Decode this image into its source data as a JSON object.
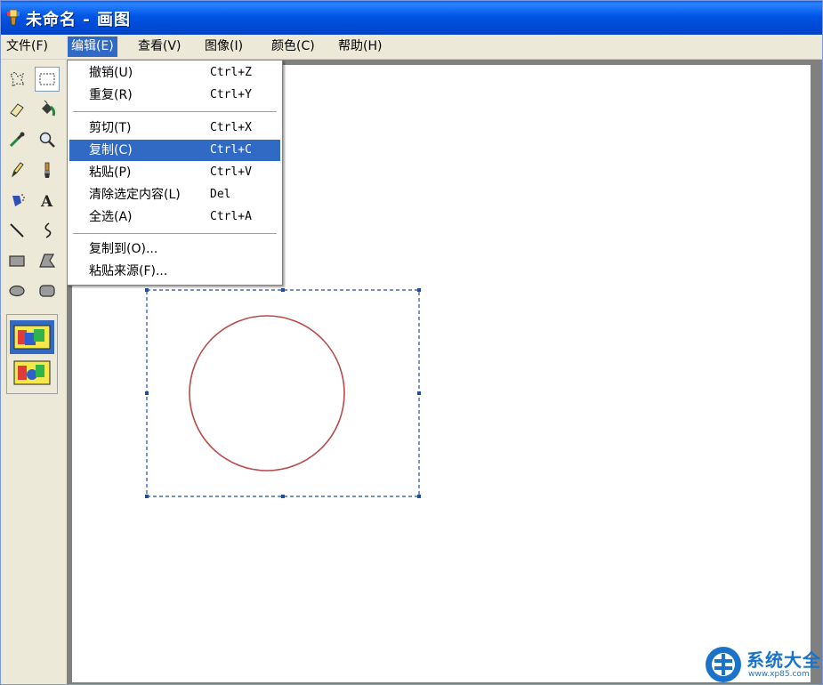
{
  "window": {
    "title": "未命名 - 画图"
  },
  "menubar": {
    "items": [
      {
        "label": "文件(F)"
      },
      {
        "label": "编辑(E)"
      },
      {
        "label": "查看(V)"
      },
      {
        "label": "图像(I)"
      },
      {
        "label": "颜色(C)"
      },
      {
        "label": "帮助(H)"
      }
    ],
    "active_index": 1
  },
  "edit_menu": {
    "items": [
      {
        "label": "撤销(U)",
        "shortcut": "Ctrl+Z"
      },
      {
        "label": "重复(R)",
        "shortcut": "Ctrl+Y"
      },
      {
        "label": "剪切(T)",
        "shortcut": "Ctrl+X"
      },
      {
        "label": "复制(C)",
        "shortcut": "Ctrl+C",
        "highlighted": true
      },
      {
        "label": "粘贴(P)",
        "shortcut": "Ctrl+V"
      },
      {
        "label": "清除选定内容(L)",
        "shortcut": "Del"
      },
      {
        "label": "全选(A)",
        "shortcut": "Ctrl+A"
      },
      {
        "label": "复制到(O)...",
        "shortcut": ""
      },
      {
        "label": "粘贴来源(F)...",
        "shortcut": ""
      }
    ]
  },
  "toolbox": {
    "tools": [
      "free-form-select-icon",
      "rectangle-select-icon",
      "eraser-icon",
      "fill-bucket-icon",
      "color-picker-icon",
      "magnifier-icon",
      "pencil-icon",
      "brush-icon",
      "airbrush-icon",
      "text-icon",
      "line-icon",
      "curve-icon",
      "rectangle-icon",
      "polygon-icon",
      "ellipse-icon",
      "rounded-rectangle-icon"
    ],
    "selected_tool": "rectangle-select-icon",
    "options": [
      "opaque-selection-icon",
      "transparent-selection-icon"
    ]
  },
  "canvas": {
    "shape": "circle",
    "stroke_color": "#b84a4a",
    "selection_border_color": "#1f4f9c"
  },
  "watermark": {
    "text": "系统大全",
    "sub": "www.xp85.com"
  },
  "colors": {
    "titlebar": "#0055e5",
    "menu_highlight": "#316ac5",
    "chrome": "#ece9d8",
    "workspace": "#808080"
  }
}
